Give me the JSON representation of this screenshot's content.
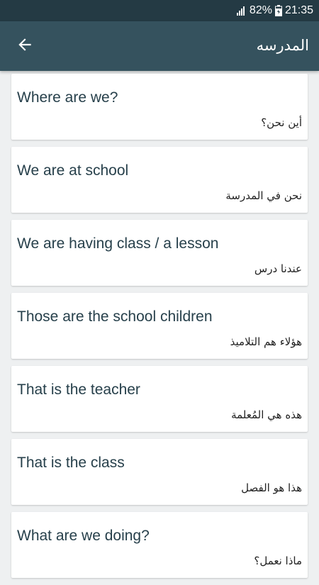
{
  "status_bar": {
    "battery": "82%",
    "time": "21:35"
  },
  "app_bar": {
    "title": "المدرسه",
    "back_icon": "arrow-left-icon"
  },
  "phrases": [
    {
      "english": "Where are we?",
      "arabic": "أين نحن؟"
    },
    {
      "english": "We are at school",
      "arabic": "نحن في المدرسة"
    },
    {
      "english": "We are having class / a lesson",
      "arabic": "عندنا درس"
    },
    {
      "english": "Those are the school children",
      "arabic": "هؤلاء هم التلاميذ"
    },
    {
      "english": "That is the teacher",
      "arabic": "هذه هي المُعلمة"
    },
    {
      "english": "That is the class",
      "arabic": "هذا هو الفصل"
    },
    {
      "english": "What are we doing?",
      "arabic": "ماذا نعمل؟"
    }
  ],
  "colors": {
    "status_bar": "#243a44",
    "app_bar": "#35525e",
    "background": "#eef0f1",
    "card": "#ffffff",
    "english_text": "#27404b"
  }
}
